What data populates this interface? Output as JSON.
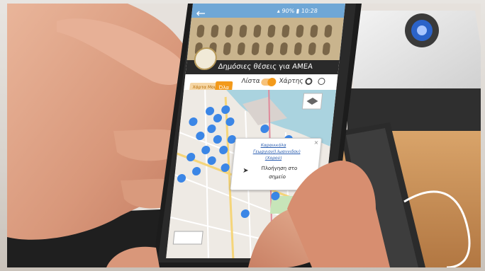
{
  "status_bar": {
    "battery": "90%",
    "time": "10:28"
  },
  "app": {
    "title": "Δημόσιες θέσεις για ΑΜΕΑ",
    "back_icon": "arrow-left-icon",
    "logo_icon": "municipal-seal-icon"
  },
  "controls": {
    "list_label": "Λίστα",
    "map_label": "Χάρτης",
    "toggle_state": "map",
    "chip_left": "Χάρτα Μου",
    "chip_right": "Όλα",
    "location_icon": "target-icon",
    "globe_icon": "globe-icon",
    "layers_icon": "layers-icon"
  },
  "popup": {
    "title_line1": "Καρανικόλα",
    "title_line2": "Γεωργιου(Ι.Ιωαννιδου)",
    "title_line3": "(Χορού)",
    "action_line1": "Πλοήγηση στο",
    "action_line2": "σημείο",
    "navigate_icon": "navigate-arrow-icon"
  },
  "colors": {
    "marker": "#3b86e6",
    "title_bar": "#2a2a2a",
    "toggle": "#f39a1b",
    "sea": "#aad3df"
  }
}
